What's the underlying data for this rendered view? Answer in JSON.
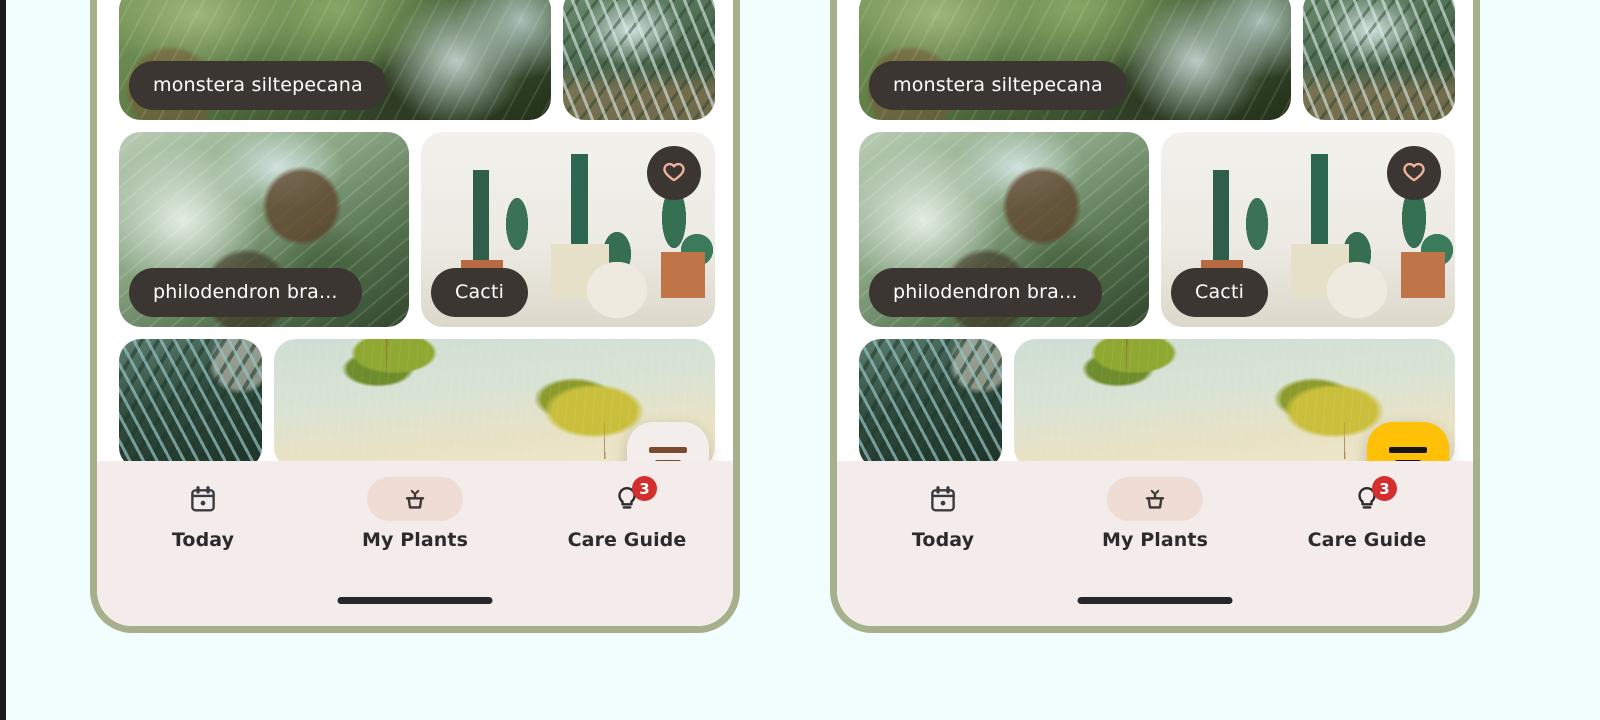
{
  "page": {
    "background_color": "#f2fdfd",
    "edge_strip_color": "#1c1c1e"
  },
  "device": {
    "frame_color": "#a7b08c",
    "screen_background": "#ffffff"
  },
  "plant_grid": {
    "cards": [
      {
        "id": "monstera",
        "label": "monstera siltepecana",
        "has_label": true,
        "has_heart": false
      },
      {
        "id": "palm",
        "label": "",
        "has_label": false,
        "has_heart": false
      },
      {
        "id": "philodendron",
        "label": "philodendron bra...",
        "has_label": true,
        "has_heart": false
      },
      {
        "id": "cacti",
        "label": "Cacti",
        "has_label": true,
        "has_heart": true
      },
      {
        "id": "fern",
        "label": "",
        "has_label": false,
        "has_heart": false
      },
      {
        "id": "ginkgo",
        "label": "",
        "has_label": false,
        "has_heart": false
      }
    ],
    "chip_background": "#3b3631",
    "chip_text_color": "#ffffff",
    "heart_icon": "heart-outline-icon",
    "heart_color": "#f0b49c"
  },
  "filter_fab": {
    "icon": "filter-icon",
    "variants": {
      "left": {
        "background": "#f3eeeb",
        "icon_color": "#7a4a2e"
      },
      "right": {
        "background": "#ffc107",
        "icon_color": "#151515"
      }
    }
  },
  "bottom_nav": {
    "background": "#f4ecea",
    "active_pill_color": "#efdcd4",
    "items": [
      {
        "label": "Today",
        "icon": "calendar-icon",
        "active": false,
        "badge": ""
      },
      {
        "label": "My Plants",
        "icon": "potted-plant-icon",
        "active": true,
        "badge": ""
      },
      {
        "label": "Care Guide",
        "icon": "lightbulb-icon",
        "active": false,
        "badge": "3"
      }
    ],
    "badge_color": "#d32f2f",
    "home_indicator_color": "#26262b"
  }
}
